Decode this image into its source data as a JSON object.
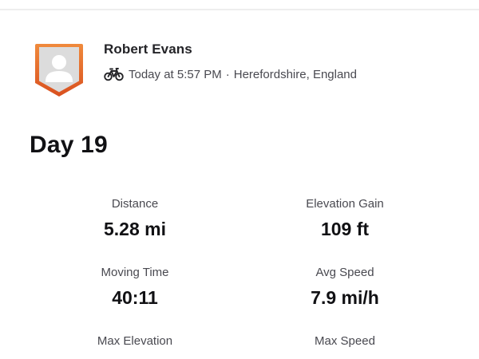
{
  "athlete": {
    "name": "Robert Evans",
    "activity_icon": "bike-icon",
    "timestamp": "Today at 5:57 PM",
    "separator": "·",
    "location": "Herefordshire, England",
    "avatar_border_color": "#e2612a"
  },
  "activity": {
    "title": "Day 19"
  },
  "stats": [
    {
      "label": "Distance",
      "value": "5.28 mi"
    },
    {
      "label": "Elevation Gain",
      "value": "109 ft"
    },
    {
      "label": "Moving Time",
      "value": "40:11"
    },
    {
      "label": "Avg Speed",
      "value": "7.9 mi/h"
    },
    {
      "label": "Max Elevation",
      "value": ""
    },
    {
      "label": "Max Speed",
      "value": ""
    }
  ]
}
